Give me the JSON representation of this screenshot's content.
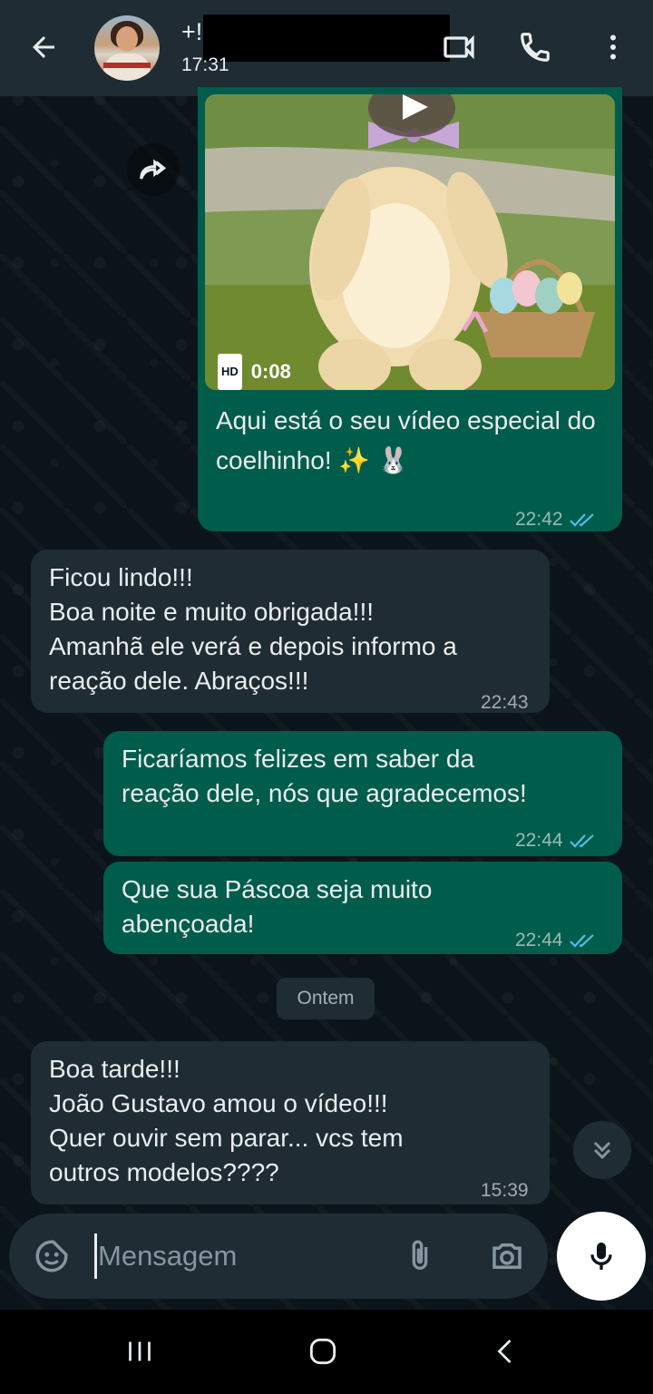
{
  "header": {
    "contact_name": "+!",
    "status": "17:31"
  },
  "messages": [
    {
      "direction": "out",
      "type": "video",
      "duration": "0:08",
      "hd_label": "HD",
      "caption": "Aqui está o seu vídeo especial do coelhinho! ✨ 🐰",
      "time": "22:42",
      "status": "read"
    },
    {
      "direction": "in",
      "text_lines": [
        "Ficou lindo!!!",
        "Boa noite e muito obrigada!!!",
        "Amanhã ele verá e depois informo a",
        "reação dele. Abraços!!!"
      ],
      "time": "22:43"
    },
    {
      "direction": "out",
      "text_lines": [
        "Ficaríamos felizes em saber da",
        "reação dele, nós que agradecemos!"
      ],
      "time": "22:44",
      "status": "read"
    },
    {
      "direction": "out",
      "text_lines": [
        "Que sua Páscoa seja muito",
        "abençoada!"
      ],
      "time": "22:44",
      "status": "read"
    },
    {
      "direction": "in",
      "text_lines": [
        "Boa tarde!!!",
        "João Gustavo amou o vídeo!!!",
        "Quer ouvir sem parar... vcs tem",
        "outros modelos????"
      ],
      "time": "15:39"
    }
  ],
  "date_separator": "Ontem",
  "input": {
    "placeholder": "Mensagem",
    "value": ""
  },
  "colors": {
    "background": "#0b141a",
    "header": "#1f2c34",
    "outgoing_bubble": "#005c4b",
    "incoming_bubble": "#1f2c34",
    "read_ticks": "#53bdeb",
    "mic_button": "#ffffff"
  },
  "icons": {
    "back": "arrow-left-icon",
    "video_call": "video-camera-icon",
    "voice_call": "phone-icon",
    "menu": "more-vertical-icon",
    "forward": "forward-icon",
    "play": "play-icon",
    "emoji": "sticker-icon",
    "attach": "paperclip-icon",
    "camera": "camera-icon",
    "mic": "microphone-icon",
    "scroll_down": "double-chevron-down-icon"
  }
}
